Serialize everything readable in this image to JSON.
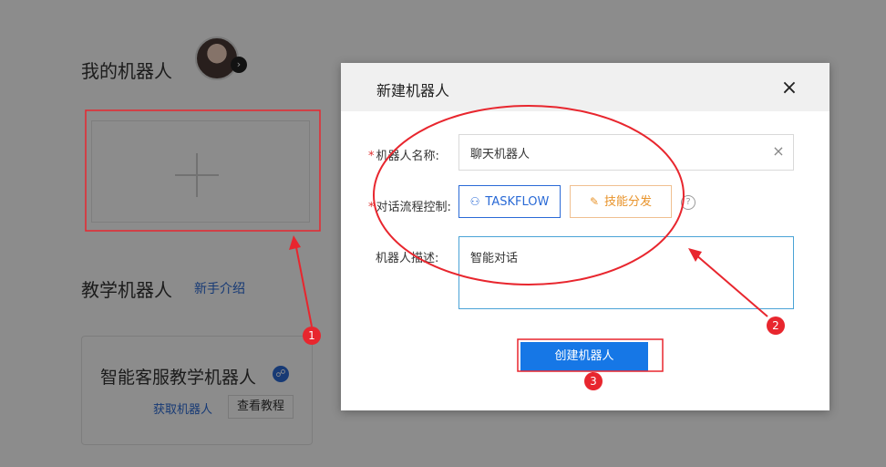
{
  "page": {
    "my_robots_title": "我的机器人",
    "teach_robots_title": "教学机器人",
    "newbie_link": "新手介绍",
    "teach_card": {
      "title": "智能客服教学机器人",
      "get_link": "获取机器人",
      "tutorial_button": "查看教程"
    }
  },
  "modal": {
    "title": "新建机器人",
    "close_icon": "×",
    "name_field": {
      "label": "机器人名称:",
      "required_mark": "*",
      "value": "聊天机器人",
      "clear_icon": "×"
    },
    "flow_control": {
      "label": "对话流程控制:",
      "required_mark": "*",
      "options": [
        {
          "label": "TASKFLOW",
          "icon": "flow-icon",
          "selected": true
        },
        {
          "label": "技能分发",
          "icon": "skill-icon",
          "selected": false
        }
      ],
      "help_icon": "?"
    },
    "description": {
      "label": "机器人描述:",
      "value": "智能对话"
    },
    "create_button": "创建机器人"
  },
  "annotations": {
    "markers": [
      "1",
      "2",
      "3"
    ],
    "color": "#e8262e"
  },
  "colors": {
    "primary": "#1677e6",
    "link": "#2a6ad6",
    "skill": "#e8932a",
    "required": "#e03030"
  }
}
